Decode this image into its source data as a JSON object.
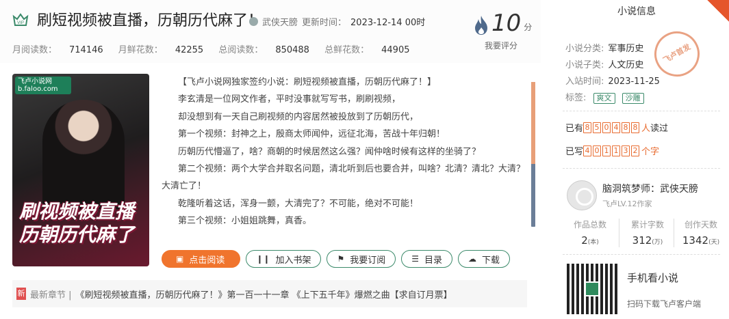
{
  "header": {
    "vip_badge": "VIP",
    "title": "刷短视频被直播，历朝历代麻了！",
    "author": "武侠天膀",
    "updated_label": "更新时间：",
    "updated_value": "2023-12-14 00时",
    "score": "10",
    "score_unit": "分",
    "rate_label": "我要评分"
  },
  "stats": {
    "month_read_label": "月阅读数：",
    "month_read": "714146",
    "month_flower_label": "月鲜花数：",
    "month_flower": "42255",
    "total_read_label": "总阅读数：",
    "total_read": "850488",
    "total_flower_label": "总鲜花数：",
    "total_flower": "44905"
  },
  "cover": {
    "site_logo": "飞卢小说网 b.faloo.com",
    "cover_title_line1": "刷视频被直播",
    "cover_title_line2": "历朝历代麻了"
  },
  "description": [
    "【飞卢小说网独家签约小说：刷短视频被直播，历朝历代麻了！】",
    "李玄清是一位网文作者，平时没事就写写书，刷刷视频，",
    "却没想到有一天自己刷视频的内容居然被投放到了历朝历代，",
    "第一个视频：封神之上，殷商太师闻仲，远征北海，苦战十年归朝！",
    "历朝历代懵逼了，啥？商朝的时候居然这么强？闻仲啥时候有这样的坐骑了？",
    "第二个视频：两个大学合并取名问题，清北听到后也要合并，叫啥？北清？清北？大清？大清亡了！",
    "乾隆听着这话，浑身一颤，大清完了？不可能，绝对不可能！",
    "第三个视频：小姐姐跳舞，真香。"
  ],
  "buttons": {
    "read": "点击阅读",
    "add_shelf": "加入书架",
    "subscribe": "我要订阅",
    "toc": "目录",
    "download": "下载"
  },
  "latest": {
    "badge": "新",
    "label": "最新章节 |",
    "text": "《刷短视频被直播，历朝历代麻了！》第一百一十一章 《上下五千年》爆燃之曲【求自订月票】"
  },
  "sidebar": {
    "title": "小说信息",
    "category_label": "小说分类:",
    "category": "军事历史",
    "subcategory_label": "小说子类:",
    "subcategory": "人文历史",
    "join_label": "入站时间:",
    "join_date": "2023-11-25",
    "tags_label": "标签:",
    "tags": [
      "爽文",
      "沙雕"
    ],
    "stamp": "飞卢首发",
    "read_prefix": "已有",
    "read_digits": [
      "8",
      "5",
      "0",
      "4",
      "8",
      "8"
    ],
    "read_suffix": "人",
    "read_tail": "读过",
    "write_prefix": "已写",
    "write_digits": [
      "4",
      "0",
      "1",
      "1",
      "3",
      "2"
    ],
    "write_suffix": "个字",
    "author_name": "脑洞筑梦师：武侠天膀",
    "author_level": "飞卢LV.12作家",
    "works_label": "作品总数",
    "works_value": "2",
    "works_unit": "(本)",
    "words_label": "累计字数",
    "words_value": "312",
    "words_unit": "(万)",
    "days_label": "创作天数",
    "days_value": "1342",
    "days_unit": "(天)",
    "mobile_title": "手机看小说",
    "scan_text": "扫码下载飞卢客户端"
  }
}
